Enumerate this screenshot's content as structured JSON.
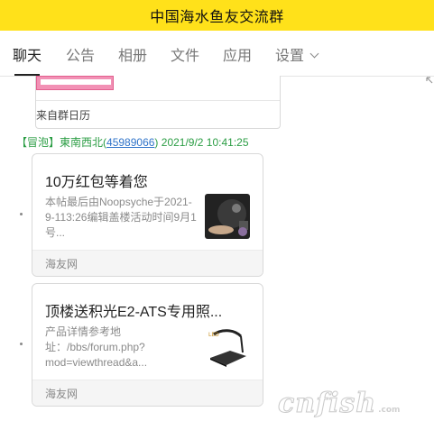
{
  "window": {
    "title": "中国海水鱼友交流群"
  },
  "tabs": [
    {
      "label": "聊天"
    },
    {
      "label": "公告"
    },
    {
      "label": "相册"
    },
    {
      "label": "文件"
    },
    {
      "label": "应用"
    },
    {
      "label": "设置"
    }
  ],
  "calendar_card": {
    "footer": "来自群日历"
  },
  "message": {
    "badge": "【冒泡】",
    "sender": "東南西北",
    "paren_open": "(",
    "qq": "45989066",
    "paren_close": ")",
    "timestamp": "2021/9/2 10:41:25"
  },
  "cards": [
    {
      "title": "10万红包等着您",
      "desc": "本帖最后由Noopsyche于2021-9-113:26编辑盖楼活动时间9月1号...",
      "source": "海友网",
      "thumb_icon": "tank-photo-icon"
    },
    {
      "title": "顶楼送积光E2-ATS专用照...",
      "desc": "产品详情参考地址：/bbs/forum.php?mod=viewthread&a...",
      "source": "海友网",
      "thumb_icon": "lamp-photo-icon"
    }
  ],
  "watermark": {
    "text": "cnfish",
    "suffix": ".com"
  }
}
